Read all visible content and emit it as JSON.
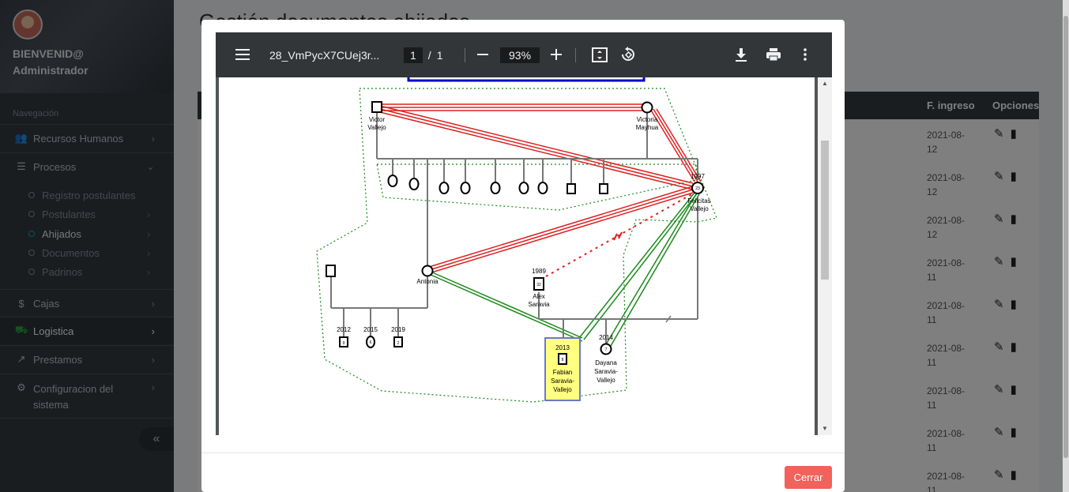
{
  "sidebar": {
    "welcome_line1": "BIENVENID@",
    "welcome_line2": "Administrador",
    "nav_header": "Navegación",
    "items": [
      {
        "label": "Recursos Humanos",
        "icon": "users-icon"
      },
      {
        "label": "Procesos",
        "icon": "list-icon"
      },
      {
        "label": "Cajas",
        "icon": "dollar-icon"
      },
      {
        "label": "Logistica",
        "icon": "truck-icon"
      },
      {
        "label": "Prestamos",
        "icon": "share-icon"
      },
      {
        "label": "Configuracion del sistema",
        "icon": "gear-icon"
      }
    ],
    "subitems": [
      {
        "label": "Registro postulantes"
      },
      {
        "label": "Postulantes"
      },
      {
        "label": "Ahijados"
      },
      {
        "label": "Documentos"
      },
      {
        "label": "Padrinos"
      }
    ],
    "collapse_glyph": "«"
  },
  "page": {
    "title": "Gestión documentos ahijados",
    "col_fingreso": "F. ingreso",
    "col_opciones": "Opciones",
    "dates": [
      "2021-08-12",
      "2021-08-12",
      "2021-08-12",
      "2021-08-11",
      "2021-08-11",
      "2021-08-11",
      "2021-08-11",
      "2021-08-11",
      "2021-08-11"
    ]
  },
  "pdf": {
    "filename": "28_VmPycX7CUej3r...",
    "page_current": "1",
    "page_sep": "/",
    "page_total": "1",
    "zoom": "93%"
  },
  "genogram": {
    "victor": [
      "Victor",
      "Vallejo"
    ],
    "victoria": [
      "Victoria",
      "Mayhua"
    ],
    "felicitas_year": "1997",
    "felicitas_age": "23",
    "felicitas": [
      "Felicitas",
      "Vallejo"
    ],
    "antonia": "Antonia",
    "alex_year": "1989",
    "alex_age": "32",
    "alex": [
      "Alex",
      "Saravia"
    ],
    "fabian_year": "2013",
    "fabian_age": "8",
    "fabian": [
      "Fabian",
      "Saravia-",
      "Vallejo"
    ],
    "dayana_year": "2014",
    "dayana_age": "7",
    "dayana": [
      "Dayana",
      "Saravia-",
      "Vallejo"
    ],
    "child_years": [
      "2012",
      "2015",
      "2019"
    ],
    "child_ages": [
      "9",
      "6",
      "2"
    ]
  },
  "modal": {
    "close_label": "Cerrar"
  },
  "colors": {
    "sidebar_bg": "#343a40",
    "close_button": "#f0625a",
    "conflict_line": "#e02020",
    "close_line": "#1a8a1a",
    "index_person_fill": "#ffff80"
  }
}
